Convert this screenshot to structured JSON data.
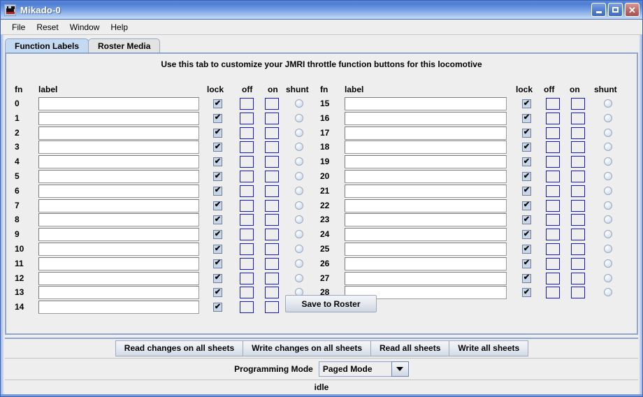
{
  "window": {
    "title": "Mikado-0",
    "icon": "locomotive-icon",
    "controls": {
      "minimize": "minimize-icon",
      "maximize": "maximize-icon",
      "close": "close-icon"
    }
  },
  "menubar": {
    "items": [
      {
        "label": "File"
      },
      {
        "label": "Reset"
      },
      {
        "label": "Window"
      },
      {
        "label": "Help"
      }
    ]
  },
  "tabs": [
    {
      "label": "Function Labels",
      "active": true
    },
    {
      "label": "Roster Media",
      "active": false
    }
  ],
  "panel": {
    "instruction": "Use this tab to customize your JMRI throttle function buttons for this locomotive",
    "column_headers": [
      "fn",
      "label",
      "lock",
      "off",
      "on",
      "shunt"
    ],
    "save_button": "Save to Roster"
  },
  "function_rows_left": [
    {
      "fn": "0",
      "label": "",
      "lock": true,
      "off": "",
      "on": "",
      "shunt": false
    },
    {
      "fn": "1",
      "label": "",
      "lock": true,
      "off": "",
      "on": "",
      "shunt": false
    },
    {
      "fn": "2",
      "label": "",
      "lock": true,
      "off": "",
      "on": "",
      "shunt": false
    },
    {
      "fn": "3",
      "label": "",
      "lock": true,
      "off": "",
      "on": "",
      "shunt": false
    },
    {
      "fn": "4",
      "label": "",
      "lock": true,
      "off": "",
      "on": "",
      "shunt": false
    },
    {
      "fn": "5",
      "label": "",
      "lock": true,
      "off": "",
      "on": "",
      "shunt": false
    },
    {
      "fn": "6",
      "label": "",
      "lock": true,
      "off": "",
      "on": "",
      "shunt": false
    },
    {
      "fn": "7",
      "label": "",
      "lock": true,
      "off": "",
      "on": "",
      "shunt": false
    },
    {
      "fn": "8",
      "label": "",
      "lock": true,
      "off": "",
      "on": "",
      "shunt": false
    },
    {
      "fn": "9",
      "label": "",
      "lock": true,
      "off": "",
      "on": "",
      "shunt": false
    },
    {
      "fn": "10",
      "label": "",
      "lock": true,
      "off": "",
      "on": "",
      "shunt": false
    },
    {
      "fn": "11",
      "label": "",
      "lock": true,
      "off": "",
      "on": "",
      "shunt": false
    },
    {
      "fn": "12",
      "label": "",
      "lock": true,
      "off": "",
      "on": "",
      "shunt": false
    },
    {
      "fn": "13",
      "label": "",
      "lock": true,
      "off": "",
      "on": "",
      "shunt": false
    },
    {
      "fn": "14",
      "label": "",
      "lock": true,
      "off": "",
      "on": "",
      "shunt": false
    }
  ],
  "function_rows_right": [
    {
      "fn": "15",
      "label": "",
      "lock": true,
      "off": "",
      "on": "",
      "shunt": false
    },
    {
      "fn": "16",
      "label": "",
      "lock": true,
      "off": "",
      "on": "",
      "shunt": false
    },
    {
      "fn": "17",
      "label": "",
      "lock": true,
      "off": "",
      "on": "",
      "shunt": false
    },
    {
      "fn": "18",
      "label": "",
      "lock": true,
      "off": "",
      "on": "",
      "shunt": false
    },
    {
      "fn": "19",
      "label": "",
      "lock": true,
      "off": "",
      "on": "",
      "shunt": false
    },
    {
      "fn": "20",
      "label": "",
      "lock": true,
      "off": "",
      "on": "",
      "shunt": false
    },
    {
      "fn": "21",
      "label": "",
      "lock": true,
      "off": "",
      "on": "",
      "shunt": false
    },
    {
      "fn": "22",
      "label": "",
      "lock": true,
      "off": "",
      "on": "",
      "shunt": false
    },
    {
      "fn": "23",
      "label": "",
      "lock": true,
      "off": "",
      "on": "",
      "shunt": false
    },
    {
      "fn": "24",
      "label": "",
      "lock": true,
      "off": "",
      "on": "",
      "shunt": false
    },
    {
      "fn": "25",
      "label": "",
      "lock": true,
      "off": "",
      "on": "",
      "shunt": false
    },
    {
      "fn": "26",
      "label": "",
      "lock": true,
      "off": "",
      "on": "",
      "shunt": false
    },
    {
      "fn": "27",
      "label": "",
      "lock": true,
      "off": "",
      "on": "",
      "shunt": false
    },
    {
      "fn": "28",
      "label": "",
      "lock": true,
      "off": "",
      "on": "",
      "shunt": false
    }
  ],
  "bottom_toolbar": {
    "buttons": [
      {
        "label": "Read changes on all sheets"
      },
      {
        "label": "Write changes on all sheets"
      },
      {
        "label": "Read all sheets"
      },
      {
        "label": "Write all sheets"
      }
    ]
  },
  "programming_mode": {
    "label": "Programming Mode",
    "selected": "Paged Mode",
    "options": [
      "Paged Mode"
    ]
  },
  "status": {
    "text": "idle"
  },
  "colors": {
    "titlebar_blue": "#4f7ed4",
    "tab_active": "#c4daf2",
    "panel_bg": "#eeeeee",
    "field_border_blue": "#1717cf",
    "accent_border": "#8fa6cf",
    "close_red": "#a94f4f"
  }
}
